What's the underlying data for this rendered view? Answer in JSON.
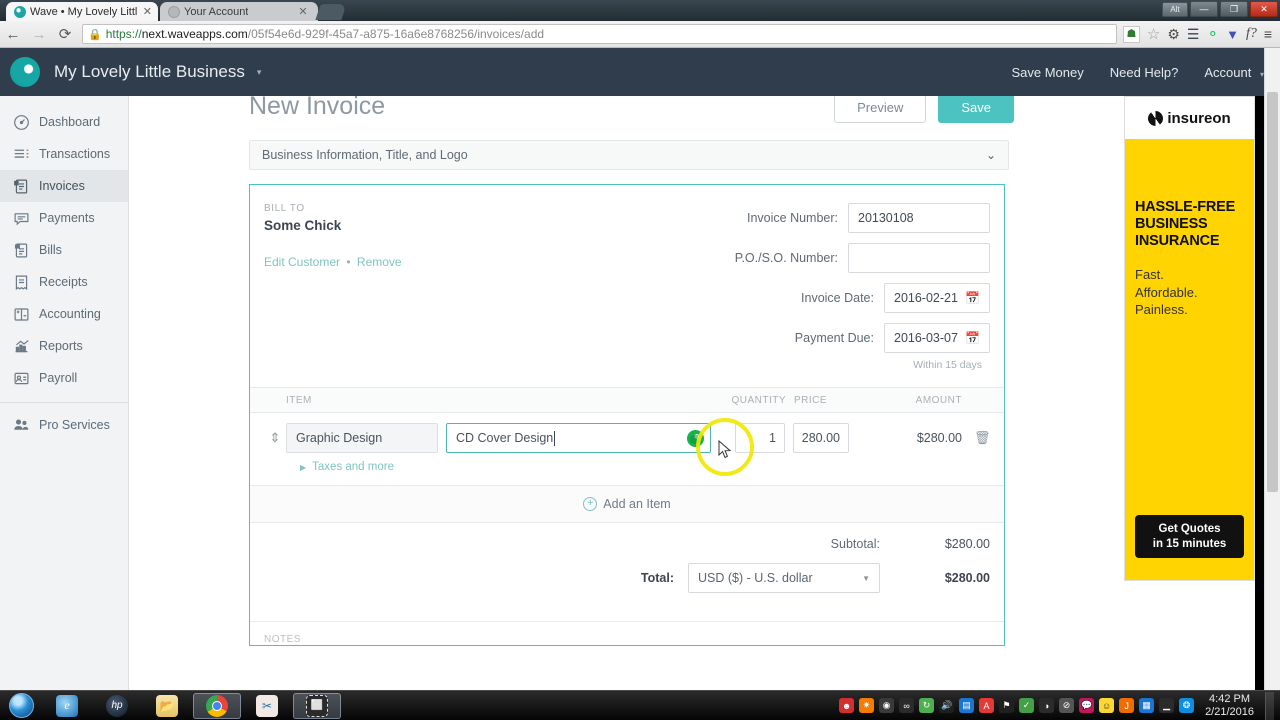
{
  "browser": {
    "tabs": [
      {
        "title": "Wave • My Lovely Little Bu",
        "favicon": "wave-favicon",
        "active": true,
        "close_label": "✕"
      },
      {
        "title": "Your Account",
        "favicon": "generic-favicon",
        "active": false,
        "close_label": "✕"
      }
    ],
    "window_controls": {
      "alt": "Alt",
      "minimize": "—",
      "maximize": "❐",
      "close": "✕"
    },
    "nav": {
      "back": "←",
      "forward": "→",
      "reload": "⟳"
    },
    "url": {
      "lock": "🔒",
      "scheme": "https://",
      "host": "next.waveapps.com",
      "path": "/05f54e6d-929f-45a7-a875-16a6e8768256/invoices/add"
    },
    "extensions": [
      "shield-extension-icon",
      "bookmark-star-icon",
      "gear-icon",
      "layers-icon",
      "grammarly-icon",
      "honey-icon",
      "fontface-icon",
      "chrome-menu-icon"
    ]
  },
  "app_header": {
    "logo": "wave-logo",
    "business_name": "My Lovely Little Business",
    "business_caret": "▾",
    "links": [
      {
        "label": "Save Money",
        "name": "save-money-link"
      },
      {
        "label": "Need Help?",
        "name": "need-help-link"
      },
      {
        "label": "Account",
        "name": "account-menu",
        "caret": "▾"
      }
    ]
  },
  "sidebar": {
    "items": [
      {
        "label": "Dashboard",
        "icon": "dashboard-icon",
        "active": false
      },
      {
        "label": "Transactions",
        "icon": "transactions-icon",
        "active": false
      },
      {
        "label": "Invoices",
        "icon": "invoices-icon",
        "active": true
      },
      {
        "label": "Payments",
        "icon": "payments-icon",
        "active": false
      },
      {
        "label": "Bills",
        "icon": "bills-icon",
        "active": false
      },
      {
        "label": "Receipts",
        "icon": "receipts-icon",
        "active": false
      },
      {
        "label": "Accounting",
        "icon": "accounting-icon",
        "active": false
      },
      {
        "label": "Reports",
        "icon": "reports-icon",
        "active": false
      },
      {
        "label": "Payroll",
        "icon": "payroll-icon",
        "active": false
      }
    ],
    "footer_item": {
      "label": "Pro Services",
      "icon": "pro-services-icon"
    }
  },
  "page": {
    "title": "New Invoice",
    "preview_label": "Preview",
    "save_label": "Save",
    "section_collapse_label": "Business Information, Title, and Logo",
    "section_chevron": "⌄"
  },
  "invoice": {
    "bill_to_label": "BILL TO",
    "customer_name": "Some Chick",
    "edit_customer_label": "Edit Customer",
    "links_separator": "•",
    "remove_label": "Remove",
    "fields": [
      {
        "label": "Invoice Number:",
        "value": "20130108",
        "type": "text",
        "name": "invoice-number-input"
      },
      {
        "label": "P.O./S.O. Number:",
        "value": "",
        "type": "text",
        "name": "po-so-number-input"
      },
      {
        "label": "Invoice Date:",
        "value": "2016-02-21",
        "type": "date",
        "name": "invoice-date-input"
      },
      {
        "label": "Payment Due:",
        "value": "2016-03-07",
        "type": "date",
        "name": "payment-due-input"
      }
    ],
    "payment_terms_note": "Within 15 days",
    "calendar_icon": "📅",
    "table": {
      "headers": [
        "ITEM",
        "QUANTITY",
        "PRICE",
        "AMOUNT"
      ],
      "rows": [
        {
          "drag_handle": "⇕",
          "item": "Graphic Design",
          "description": "CD Cover Design",
          "quantity": "1",
          "price": "280.00",
          "amount": "$280.00",
          "delete_icon": "🗑",
          "taxes_label": "Taxes and more",
          "taxes_triangle": "▶",
          "description_focused": true,
          "spinner_visible": true
        }
      ]
    },
    "add_item_label": "Add an Item",
    "add_item_plus": "+",
    "subtotal_label": "Subtotal:",
    "subtotal_value": "$280.00",
    "total_label": "Total:",
    "total_value": "$280.00",
    "currency_value": "USD ($) - U.S. dollar",
    "currency_caret": "▼",
    "notes_label": "NOTES"
  },
  "ad": {
    "brand": "insureon",
    "headline": "HASSLE-FREE BUSINESS INSURANCE",
    "sub_line_1": "Fast.",
    "sub_line_2": "Affordable.",
    "sub_line_3": "Painless.",
    "cta_line_1": "Get Quotes",
    "cta_line_2": "in 15 minutes"
  },
  "taskbar": {
    "start": "start-orb",
    "apps": [
      {
        "name": "internet-explorer-icon",
        "glyph": "e",
        "open": false
      },
      {
        "name": "hp-icon",
        "glyph": "hp",
        "open": false
      },
      {
        "name": "file-explorer-icon",
        "glyph": "🗂",
        "open": false
      },
      {
        "name": "google-chrome-icon",
        "glyph": "◉",
        "open": true
      },
      {
        "name": "snipping-tool-icon",
        "glyph": "✂",
        "open": false
      },
      {
        "name": "screen-capture-icon",
        "glyph": "⬚",
        "open": true
      }
    ],
    "tray_icons": [
      "red-app-icon",
      "orange-star-icon",
      "camera-icon",
      "link-icon",
      "green-sync-icon",
      "volume-icon",
      "blue-card-icon",
      "adobe-reader-icon",
      "flag-icon",
      "security-check-icon",
      "wireless-icon",
      "block-icon",
      "chat-icon",
      "smiley-icon",
      "java-icon",
      "windows-icon",
      "signal-icon",
      "dropbox-icon"
    ],
    "time": "4:42 PM",
    "date": "2/21/2016"
  },
  "colors": {
    "brand_teal": "#4cc3c1",
    "header_navy": "#2f3d4c",
    "ad_yellow": "#ffd400",
    "highlight_yellow": "#f2e705",
    "link_teal": "#7fc4c2"
  }
}
